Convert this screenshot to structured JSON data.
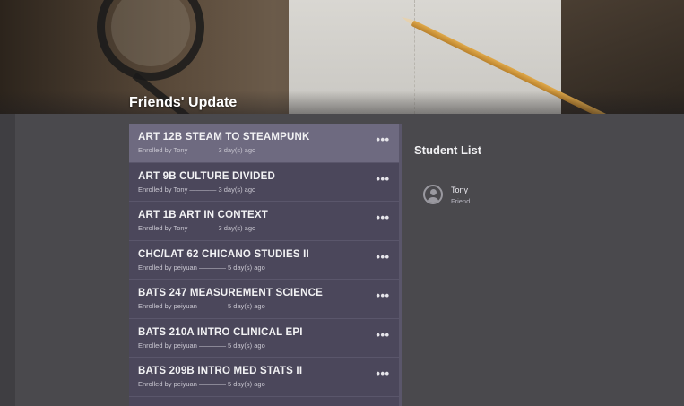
{
  "header": {
    "title": "Friends' Update"
  },
  "feed": {
    "items": [
      {
        "title": "ART 12B STEAM TO STEAMPUNK",
        "meta": "Enrolled by Tony ———— 3 day(s) ago",
        "more": "•••"
      },
      {
        "title": "ART 9B CULTURE DIVIDED",
        "meta": "Enrolled by Tony ———— 3 day(s) ago",
        "more": "•••"
      },
      {
        "title": "ART 1B ART IN CONTEXT",
        "meta": "Enrolled by Tony ———— 3 day(s) ago",
        "more": "•••"
      },
      {
        "title": "CHC/LAT 62 CHICANO STUDIES II",
        "meta": "Enrolled by peiyuan ———— 5 day(s) ago",
        "more": "•••"
      },
      {
        "title": "BATS 247 MEASUREMENT SCIENCE",
        "meta": "Enrolled by peiyuan ———— 5 day(s) ago",
        "more": "•••"
      },
      {
        "title": "BATS 210A INTRO CLINICAL EPI",
        "meta": "Enrolled by peiyuan ———— 5 day(s) ago",
        "more": "•••"
      },
      {
        "title": "BATS 209B INTRO MED STATS II",
        "meta": "Enrolled by peiyuan ———— 5 day(s) ago",
        "more": "•••"
      }
    ]
  },
  "student_list": {
    "title": "Student List",
    "students": [
      {
        "name": "Tony",
        "role": "Friend",
        "icon": "person-icon"
      }
    ]
  },
  "colors": {
    "feed_background": "#4b475b",
    "feed_active": "#6e6a80",
    "page_background": "#4a494d"
  }
}
